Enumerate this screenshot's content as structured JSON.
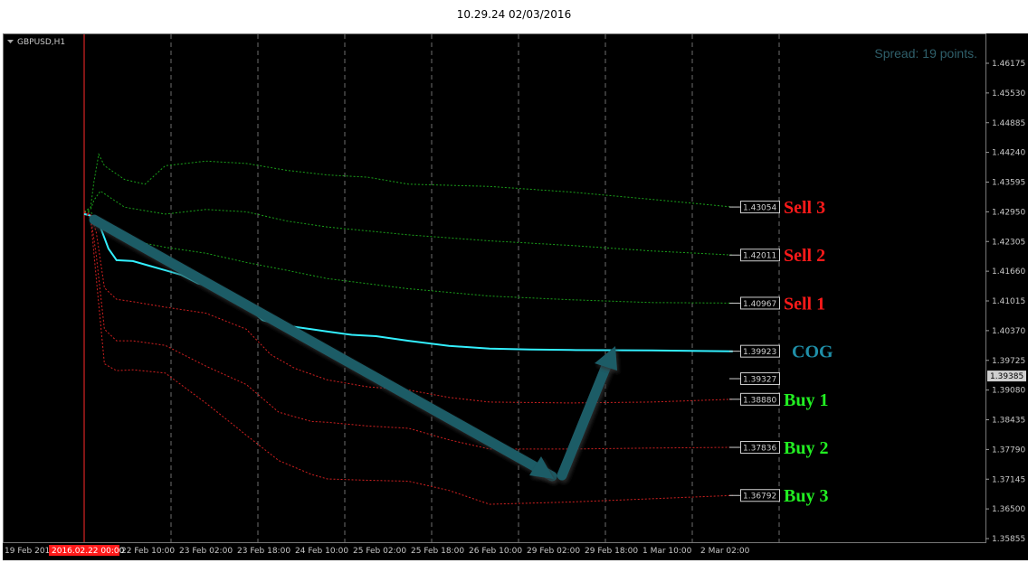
{
  "header": {
    "title": "10.29.24 02/03/2016"
  },
  "chart": {
    "symbol_label": "GBPUSD,H1",
    "spread_text": "Spread: 19 points.",
    "current_price": "1.39385",
    "current_time_label": "2016.02.22 00:00"
  },
  "colors": {
    "background": "#000000",
    "grid": "#6e6e6e",
    "axis_text": "#c8c8c8",
    "cog_line": "#33f0ff",
    "upper_bands": "#1aa01a",
    "lower_bands": "#d02020",
    "arrow": "#1f5c66",
    "sell_text": "#ff1a1a",
    "buy_text": "#22ee22",
    "cog_text": "#1f8fa8",
    "vline": "#ff2a2a"
  },
  "chart_data": {
    "type": "line",
    "x_ticks": [
      "19 Feb 2016",
      "22 Feb 10:00",
      "23 Feb 02:00",
      "23 Feb 18:00",
      "24 Feb 10:00",
      "25 Feb 02:00",
      "25 Feb 18:00",
      "26 Feb 10:00",
      "29 Feb 02:00",
      "29 Feb 18:00",
      "1 Mar 10:00",
      "2 Mar 02:00"
    ],
    "y_ticks": [
      "1.46175",
      "1.45530",
      "1.44885",
      "1.44240",
      "1.43595",
      "1.42950",
      "1.42305",
      "1.41660",
      "1.41015",
      "1.40370",
      "1.39725",
      "1.39080",
      "1.38435",
      "1.37790",
      "1.37145",
      "1.36500",
      "1.35855"
    ],
    "ylim": [
      1.3585,
      1.4685
    ],
    "series": [
      {
        "name": "Sell 3",
        "value_label": "1.43054",
        "end_value": 1.43054,
        "points": [
          [
            0,
            1.4295
          ],
          [
            0.08,
            1.4305
          ],
          [
            0.12,
            1.436
          ],
          [
            0.18,
            1.442
          ],
          [
            0.25,
            1.4395
          ],
          [
            0.5,
            1.4365
          ],
          [
            0.75,
            1.4355
          ],
          [
            1.0,
            1.4395
          ],
          [
            1.5,
            1.4405
          ],
          [
            2.0,
            1.44
          ],
          [
            2.5,
            1.4385
          ],
          [
            3.0,
            1.4375
          ],
          [
            3.5,
            1.437
          ],
          [
            4.0,
            1.4355
          ],
          [
            5.0,
            1.435
          ],
          [
            6.0,
            1.4338
          ],
          [
            7.0,
            1.4322
          ],
          [
            8.0,
            1.43054
          ]
        ]
      },
      {
        "name": "Sell 2",
        "value_label": "1.42011",
        "end_value": 1.42011,
        "points": [
          [
            0,
            1.4295
          ],
          [
            0.08,
            1.43
          ],
          [
            0.12,
            1.432
          ],
          [
            0.2,
            1.434
          ],
          [
            0.5,
            1.4305
          ],
          [
            1.0,
            1.429
          ],
          [
            1.5,
            1.43
          ],
          [
            2.0,
            1.4295
          ],
          [
            2.5,
            1.4275
          ],
          [
            3.0,
            1.4262
          ],
          [
            4.0,
            1.4245
          ],
          [
            5.0,
            1.4232
          ],
          [
            6.0,
            1.4222
          ],
          [
            7.0,
            1.421
          ],
          [
            8.0,
            1.42011
          ]
        ]
      },
      {
        "name": "Sell 1",
        "value_label": "1.40967",
        "end_value": 1.40967,
        "points": [
          [
            0,
            1.4295
          ],
          [
            0.08,
            1.4295
          ],
          [
            0.15,
            1.428
          ],
          [
            0.5,
            1.4235
          ],
          [
            1.0,
            1.4218
          ],
          [
            1.5,
            1.4205
          ],
          [
            2.0,
            1.4185
          ],
          [
            2.5,
            1.4168
          ],
          [
            3.0,
            1.415
          ],
          [
            4.0,
            1.4128
          ],
          [
            5.0,
            1.4112
          ],
          [
            6.0,
            1.4104
          ],
          [
            7.0,
            1.4098
          ],
          [
            8.0,
            1.40967
          ]
        ]
      },
      {
        "name": "COG",
        "value_label": "1.39923",
        "end_value": 1.39923,
        "points": [
          [
            0,
            1.429
          ],
          [
            0.05,
            1.4288
          ],
          [
            0.1,
            1.4285
          ],
          [
            0.2,
            1.4262
          ],
          [
            0.3,
            1.4215
          ],
          [
            0.4,
            1.419
          ],
          [
            0.6,
            1.4188
          ],
          [
            0.8,
            1.4178
          ],
          [
            1.0,
            1.4168
          ],
          [
            1.2,
            1.4158
          ],
          [
            1.4,
            1.414
          ],
          [
            1.6,
            1.413
          ],
          [
            1.8,
            1.4115
          ],
          [
            2.0,
            1.409
          ],
          [
            2.2,
            1.406
          ],
          [
            2.4,
            1.405
          ],
          [
            2.6,
            1.4045
          ],
          [
            2.8,
            1.404
          ],
          [
            3.0,
            1.4035
          ],
          [
            3.3,
            1.4028
          ],
          [
            3.6,
            1.4025
          ],
          [
            4.0,
            1.4015
          ],
          [
            4.5,
            1.4004
          ],
          [
            5.0,
            1.3998
          ],
          [
            5.5,
            1.3996
          ],
          [
            6.0,
            1.3995
          ],
          [
            7.0,
            1.3994
          ],
          [
            8.0,
            1.39923
          ]
        ]
      },
      {
        "name": "",
        "value_label": "1.39327",
        "end_value": 1.39327,
        "points": []
      },
      {
        "name": "Buy 1",
        "value_label": "1.38880",
        "end_value": 1.3888,
        "points": [
          [
            0,
            1.4295
          ],
          [
            0.08,
            1.429
          ],
          [
            0.15,
            1.425
          ],
          [
            0.25,
            1.413
          ],
          [
            0.4,
            1.4105
          ],
          [
            0.6,
            1.41
          ],
          [
            1.0,
            1.4088
          ],
          [
            1.5,
            1.4075
          ],
          [
            2.0,
            1.404
          ],
          [
            2.3,
            1.3985
          ],
          [
            2.6,
            1.3955
          ],
          [
            3.0,
            1.393
          ],
          [
            3.5,
            1.3915
          ],
          [
            4.0,
            1.3908
          ],
          [
            4.5,
            1.3892
          ],
          [
            5.0,
            1.3882
          ],
          [
            6.0,
            1.388
          ],
          [
            7.0,
            1.3882
          ],
          [
            8.0,
            1.3888
          ]
        ]
      },
      {
        "name": "Buy 2",
        "value_label": "1.37836",
        "end_value": 1.37836,
        "points": [
          [
            0,
            1.4295
          ],
          [
            0.08,
            1.4285
          ],
          [
            0.15,
            1.42
          ],
          [
            0.25,
            1.404
          ],
          [
            0.4,
            1.4015
          ],
          [
            0.6,
            1.4015
          ],
          [
            1.0,
            1.4005
          ],
          [
            1.5,
            1.396
          ],
          [
            2.0,
            1.392
          ],
          [
            2.4,
            1.386
          ],
          [
            2.8,
            1.384
          ],
          [
            3.0,
            1.3838
          ],
          [
            3.5,
            1.383
          ],
          [
            4.0,
            1.3825
          ],
          [
            4.5,
            1.38
          ],
          [
            5.0,
            1.378
          ],
          [
            6.0,
            1.378
          ],
          [
            7.0,
            1.3782
          ],
          [
            8.0,
            1.37836
          ]
        ]
      },
      {
        "name": "Buy 3",
        "value_label": "1.36792",
        "end_value": 1.36792,
        "points": [
          [
            0,
            1.4295
          ],
          [
            0.08,
            1.428
          ],
          [
            0.15,
            1.415
          ],
          [
            0.25,
            1.3965
          ],
          [
            0.4,
            1.395
          ],
          [
            0.6,
            1.3952
          ],
          [
            1.0,
            1.3945
          ],
          [
            1.5,
            1.388
          ],
          [
            2.0,
            1.381
          ],
          [
            2.4,
            1.3755
          ],
          [
            2.8,
            1.3725
          ],
          [
            3.0,
            1.3715
          ],
          [
            3.5,
            1.3712
          ],
          [
            4.0,
            1.371
          ],
          [
            4.5,
            1.369
          ],
          [
            5.0,
            1.366
          ],
          [
            6.0,
            1.3665
          ],
          [
            7.0,
            1.3672
          ],
          [
            8.0,
            1.36792
          ]
        ]
      }
    ]
  }
}
